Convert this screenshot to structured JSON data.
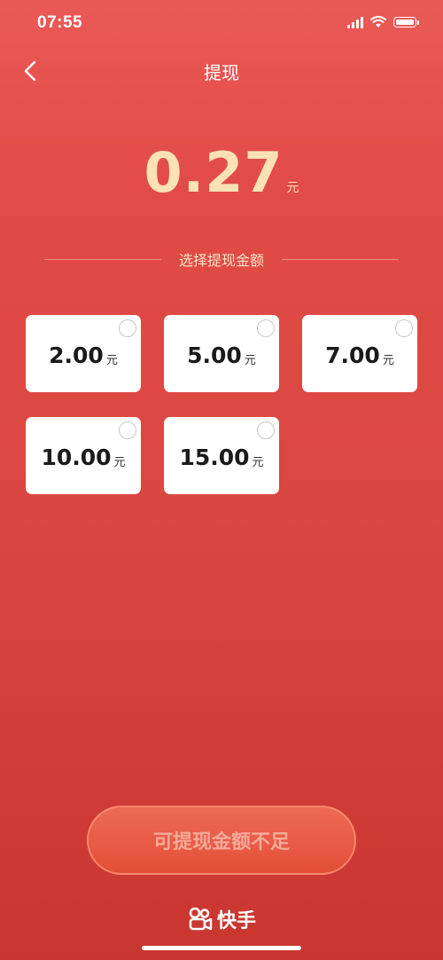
{
  "status_bar": {
    "time": "07:55"
  },
  "nav": {
    "title": "提现"
  },
  "balance": {
    "amount": "0.27",
    "unit": "元"
  },
  "section": {
    "label": "选择提现金额"
  },
  "options": [
    {
      "value": "2.00",
      "unit": "元"
    },
    {
      "value": "5.00",
      "unit": "元"
    },
    {
      "value": "7.00",
      "unit": "元"
    },
    {
      "value": "10.00",
      "unit": "元"
    },
    {
      "value": "15.00",
      "unit": "元"
    }
  ],
  "button": {
    "label": "可提现金额不足"
  },
  "brand": {
    "name": "快手",
    "logo_icon": "kuaishou-logo-icon"
  },
  "colors": {
    "background": "#e24b46",
    "accent_gold": "#fbe2b2",
    "button": "#e85a45"
  }
}
